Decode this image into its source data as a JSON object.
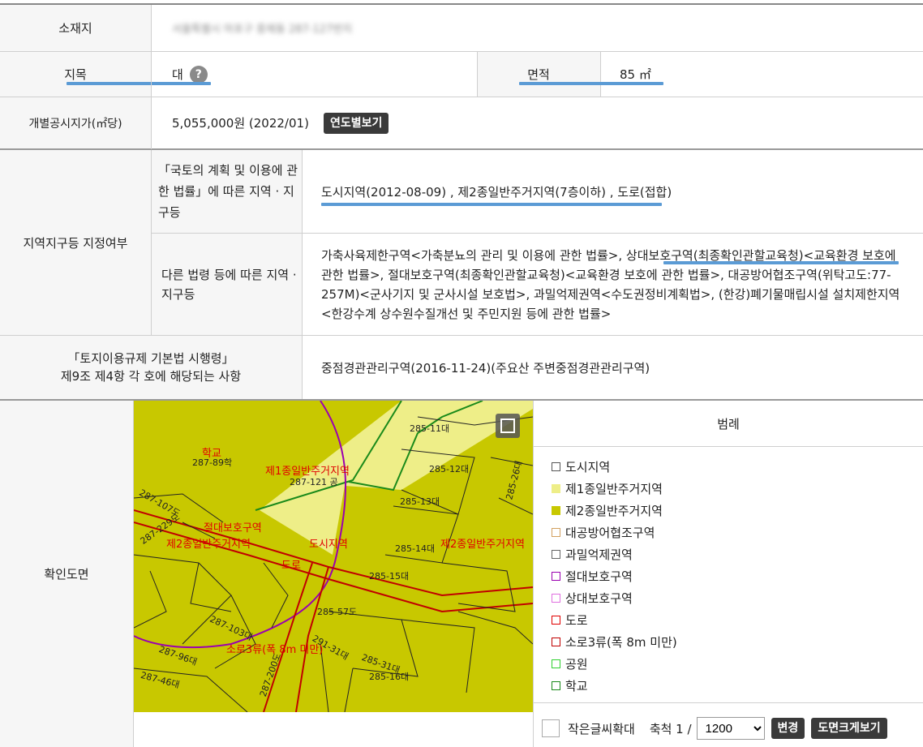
{
  "rows": {
    "location": {
      "label": "소재지",
      "value": "서울특별시 마포구 중제동 287-127번지"
    },
    "land_category": {
      "label": "지목",
      "value": "대",
      "help": "?"
    },
    "area": {
      "label": "면적",
      "value": "85 ㎡"
    },
    "official_price": {
      "label": "개별공시지가(㎡당)",
      "value": "5,055,000원 (2022/01)",
      "button": "연도별보기"
    },
    "zoning": {
      "label": "지역지구등 지정여부",
      "sub1": {
        "label": "「국토의 계획 및 이용에 관한 법률」에 따른 지역 · 지구등",
        "value": "도시지역(2012-08-09) , 제2종일반주거지역(7층이하) , 도로(접합)"
      },
      "sub2": {
        "label": "다른 법령 등에 따른 지역 · 지구등",
        "value": "가축사육제한구역<가축분뇨의 관리 및 이용에 관한 법률>, 상대보호구역(최종확인관할교육청)<교육환경 보호에 관한 법률>, 절대보호구역(최종확인관할교육청)<교육환경 보호에 관한 법률>, 대공방어협조구역(위탁고도:77-257M)<군사기지 및 군사시설 보호법>, 과밀억제권역<수도권정비계획법>, (한강)폐기물매립시설 설치제한지역<한강수계 상수원수질개선 및 주민지원 등에 관한 법률>"
      }
    },
    "regulation": {
      "label_line1": "「토지이용규제 기본법 시행령」",
      "label_line2": "제9조 제4항 각 호에 해당되는 사항",
      "value": "중점경관관리구역(2016-11-24)(주요산 주변중점경관관리구역)"
    },
    "map": {
      "label": "확인도면"
    }
  },
  "legend": {
    "title": "범례",
    "items": [
      {
        "label": "도시지역",
        "fill": "#ffffff",
        "border": "#555555"
      },
      {
        "label": "제1종일반주거지역",
        "fill": "#eeee88",
        "border": "#eeee88"
      },
      {
        "label": "제2종일반주거지역",
        "fill": "#c8c800",
        "border": "#c8c800"
      },
      {
        "label": "대공방어협조구역",
        "fill": "#ffffff",
        "border": "#d2a060"
      },
      {
        "label": "과밀억제권역",
        "fill": "#ffffff",
        "border": "#666666"
      },
      {
        "label": "절대보호구역",
        "fill": "#ffffff",
        "border": "#9a00b0"
      },
      {
        "label": "상대보호구역",
        "fill": "#ffffff",
        "border": "#e070e0"
      },
      {
        "label": "도로",
        "fill": "#ffffff",
        "border": "#e00000"
      },
      {
        "label": "소로3류(폭 8m 미만)",
        "fill": "#ffffff",
        "border": "#c00000"
      },
      {
        "label": "공원",
        "fill": "#ffffff",
        "border": "#30d030"
      },
      {
        "label": "학교",
        "fill": "#ffffff",
        "border": "#1a8a1a"
      }
    ]
  },
  "controls": {
    "small_text_label": "작은글씨확대",
    "scale_label": "축척 1 /",
    "scale_value": "1200",
    "change_button": "변경",
    "enlarge_button": "도면크게보기"
  },
  "map_labels": {
    "school": "학교",
    "p287_89": "287-89학",
    "zone1": "제1종일반주거지역",
    "p287_121": "287-121 공",
    "absolute_zone": "절대보호구역",
    "zone2_left": "제2종일반주거지역",
    "urban": "도시지역",
    "zone2_right": "제2종일반주거지역",
    "road": "도로",
    "small_road": "소로3류(폭 8m 미만)",
    "p285_11": "285-11대",
    "p285_12": "285-12대",
    "p285_13": "285-13대",
    "p285_14": "285-14대",
    "p285_15": "285-15대",
    "p285_16": "285-16대",
    "p285_57": "285-57도",
    "p285_26": "285-26대",
    "p287_107": "287-107도",
    "p287_103": "287-103대",
    "p287_46": "287-46대",
    "p287_229": "287-229도",
    "p287_96": "287-96대",
    "p291_31": "291-31대",
    "p285_31": "285-31대",
    "p287_200": "287-200도"
  },
  "colors": {
    "zone2": "#c8c800",
    "zone1": "#eeee88",
    "road_line": "#e00000",
    "school_line": "#1a8a1a",
    "absolute_line": "#9a00b0",
    "underline": "#5b9bd5"
  }
}
